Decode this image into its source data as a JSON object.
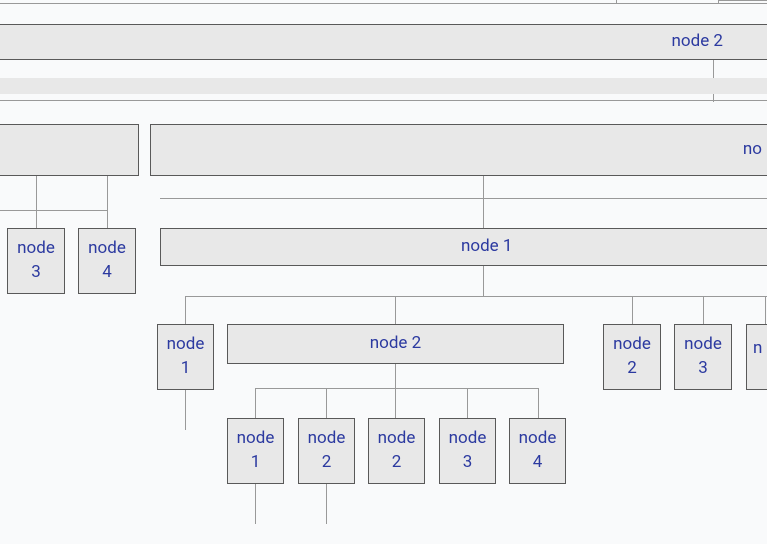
{
  "nodes": {
    "top_partial_left": "",
    "top_partial_right": "",
    "row1_node2": "node 2",
    "row1_small": "",
    "row2_left": "",
    "row2_right": "no",
    "row3_node3": "node 3",
    "row3_node4": "node 4",
    "row3_node1": "node 1",
    "row4_n1": "node 1",
    "row4_n2_big": "node 2",
    "row4_n2": "node 2",
    "row4_n3": "node 3",
    "row4_right": "n",
    "row5_n1": "node 1",
    "row5_n2a": "node 2",
    "row5_n2b": "node 2",
    "row5_n3": "node 3",
    "row5_n4": "node 4"
  }
}
